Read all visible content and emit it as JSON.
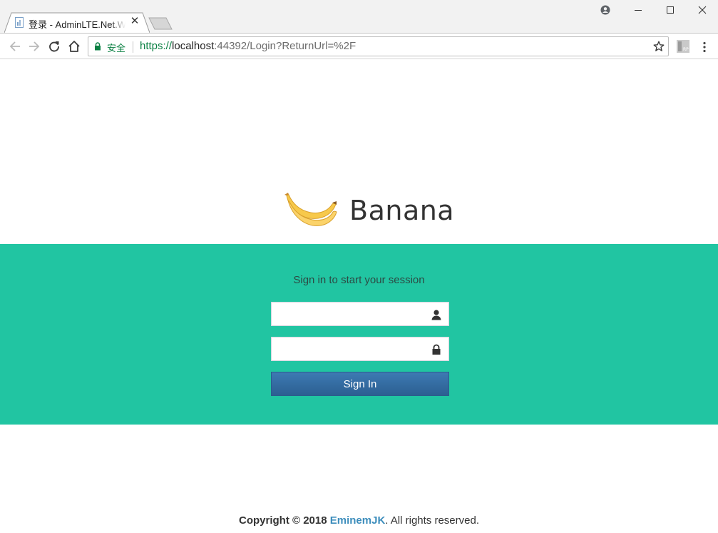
{
  "browser": {
    "tab": {
      "title": "登录 - AdminLTE.Net.Web",
      "close_glyph": "✕"
    },
    "omnibox": {
      "security_label": "安全",
      "url_scheme": "https://",
      "url_host": "localhost",
      "url_rest": ":44392/Login?ReturnUrl=%2F"
    },
    "icons": {
      "back": "arrow-left-icon",
      "forward": "arrow-right-icon",
      "reload": "reload-icon",
      "home": "home-icon",
      "lock": "lock-icon",
      "bookmark": "star-icon",
      "extension": "rp-extension-icon",
      "menu": "kebab-menu-icon",
      "profile": "account-icon",
      "minimize": "minimize-icon",
      "maximize": "maximize-icon",
      "close": "close-icon"
    },
    "colors": {
      "secure": "#0b8043"
    }
  },
  "page": {
    "brand": "Banana",
    "login_box_msg": "Sign in to start your session",
    "username": {
      "value": "",
      "placeholder": ""
    },
    "password": {
      "value": "",
      "placeholder": ""
    },
    "signin_label": "Sign In",
    "footer": {
      "copyright": "Copyright © 2018",
      "author": "EminemJK",
      "rights": ". All rights reserved."
    },
    "colors": {
      "band": "#21c5a2",
      "button": "#3d7ab3",
      "link": "#3c8dbc"
    }
  }
}
